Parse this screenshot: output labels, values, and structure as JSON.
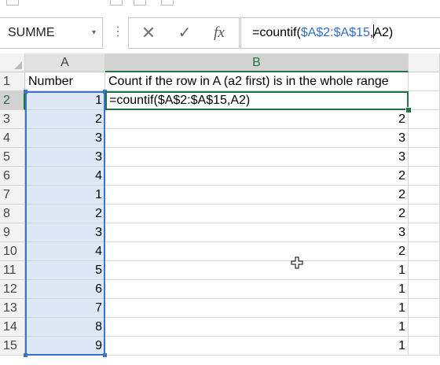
{
  "formula_bar": {
    "name_box": "SUMME",
    "formula_prefix": "=countif(",
    "formula_ref": "$A$2:$A$15",
    "formula_suffix": "A2)",
    "comma": ","
  },
  "columns": {
    "a": "A",
    "b": "B"
  },
  "rows": [
    {
      "n": "1",
      "a": "Number",
      "b": "Count if the row in A (a2 first) is in the whole range"
    },
    {
      "n": "2",
      "a": "1",
      "b": ""
    },
    {
      "n": "3",
      "a": "2",
      "b": "2"
    },
    {
      "n": "4",
      "a": "3",
      "b": "3"
    },
    {
      "n": "5",
      "a": "3",
      "b": "3"
    },
    {
      "n": "6",
      "a": "4",
      "b": "2"
    },
    {
      "n": "7",
      "a": "1",
      "b": "2"
    },
    {
      "n": "8",
      "a": "2",
      "b": "2"
    },
    {
      "n": "9",
      "a": "3",
      "b": "3"
    },
    {
      "n": "10",
      "a": "4",
      "b": "2"
    },
    {
      "n": "11",
      "a": "5",
      "b": "1"
    },
    {
      "n": "12",
      "a": "6",
      "b": "1"
    },
    {
      "n": "13",
      "a": "7",
      "b": "1"
    },
    {
      "n": "14",
      "a": "8",
      "b": "1"
    },
    {
      "n": "15",
      "a": "9",
      "b": "1"
    }
  ],
  "active_cell_text": "=countif($A$2:$A$15,A2)",
  "colors": {
    "accent": "#217346",
    "reference": "#2f6fc6",
    "selection": "#dde8f7"
  },
  "icons": {
    "cancel": "cancel-x-icon",
    "enter": "checkmark-icon",
    "function": "fx-icon"
  }
}
